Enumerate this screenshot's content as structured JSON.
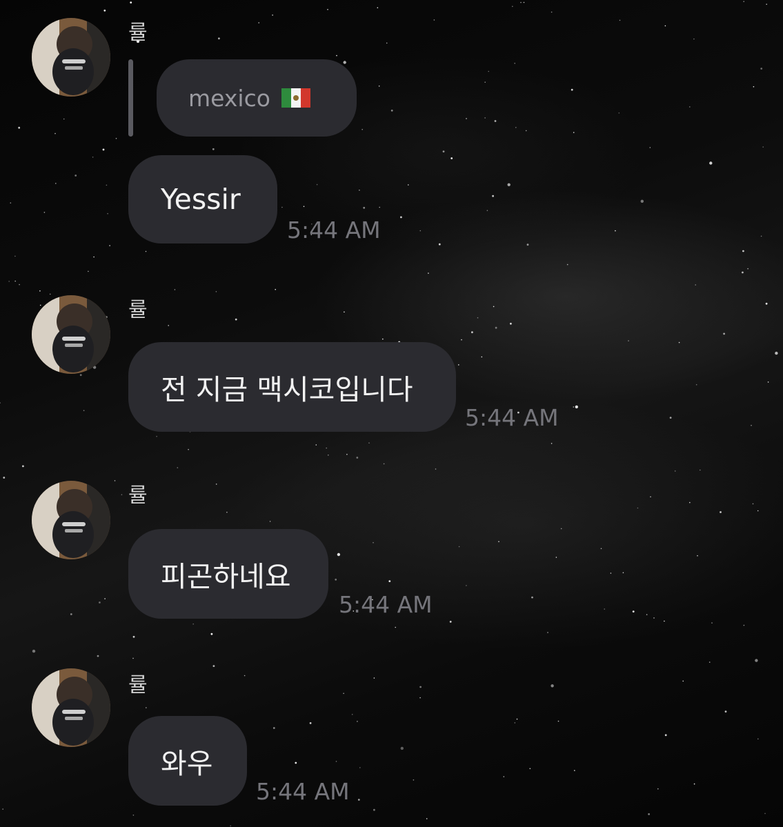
{
  "messages": [
    {
      "sender": "률",
      "reply": {
        "text": "mexico",
        "emoji": "mexico-flag"
      },
      "text": "Yessir",
      "time": "5:44 AM"
    },
    {
      "sender": "률",
      "text": "전 지금 맥시코입니다",
      "time": "5:44 AM"
    },
    {
      "sender": "률",
      "text": "피곤하네요",
      "time": "5:44 AM"
    },
    {
      "sender": "률",
      "text": "와우",
      "time": "5:44 AM"
    }
  ],
  "colors": {
    "bubble": "#2b2b30",
    "bubble_text": "#f2f2f2",
    "timestamp": "#75757b",
    "sender_name": "#d2d2d2",
    "background": "#000000"
  }
}
